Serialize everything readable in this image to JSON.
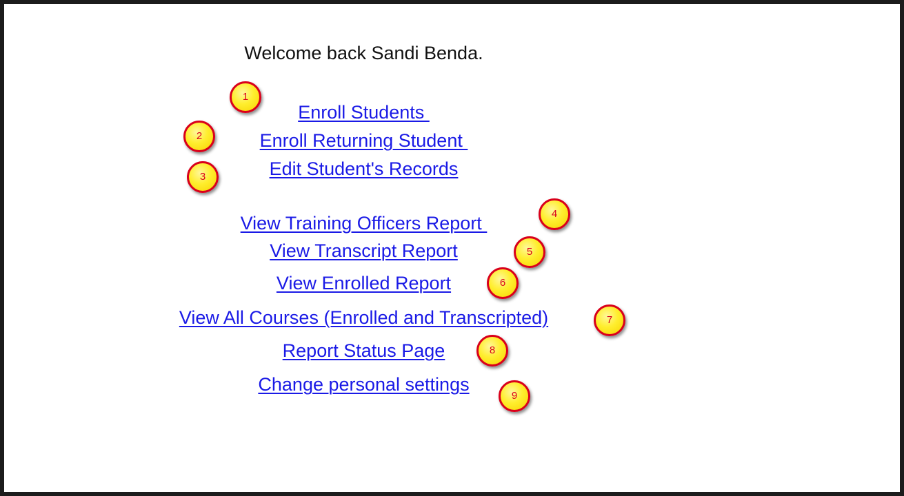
{
  "welcome": "Welcome back Sandi Benda.",
  "links": [
    {
      "label": "Enroll Students "
    },
    {
      "label": "Enroll Returning Student "
    },
    {
      "label": "Edit Student's Records"
    },
    {
      "label": "View Training Officers Report "
    },
    {
      "label": "View Transcript Report"
    },
    {
      "label": "View Enrolled Report"
    },
    {
      "label": "View All Courses (Enrolled and Transcripted)"
    },
    {
      "label": "Report Status Page"
    },
    {
      "label": "Change personal settings"
    }
  ],
  "markers": [
    "1",
    "2",
    "3",
    "4",
    "5",
    "6",
    "7",
    "8",
    "9"
  ],
  "colors": {
    "link": "#1a1ae6",
    "marker_fill": "#ffee2e",
    "marker_border": "#d9001b",
    "frame": "#1c1c1c"
  }
}
